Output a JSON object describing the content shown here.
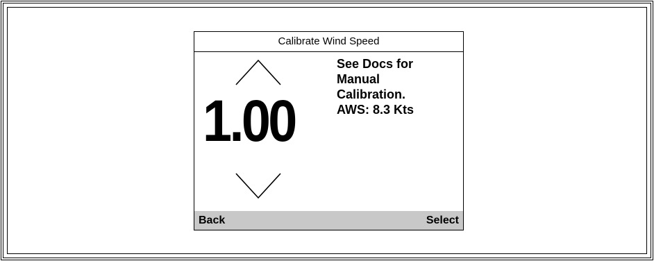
{
  "screen": {
    "title": "Calibrate Wind Speed",
    "value": "1.00",
    "info_lines": [
      "See Docs for",
      "Manual",
      "Calibration."
    ],
    "aws": "AWS: 8.3 Kts",
    "footer": {
      "back_label": "Back",
      "select_label": "Select",
      "background": "#c8c8c8"
    },
    "icons": {
      "increase": "chevron-up-icon",
      "decrease": "chevron-down-icon"
    }
  }
}
